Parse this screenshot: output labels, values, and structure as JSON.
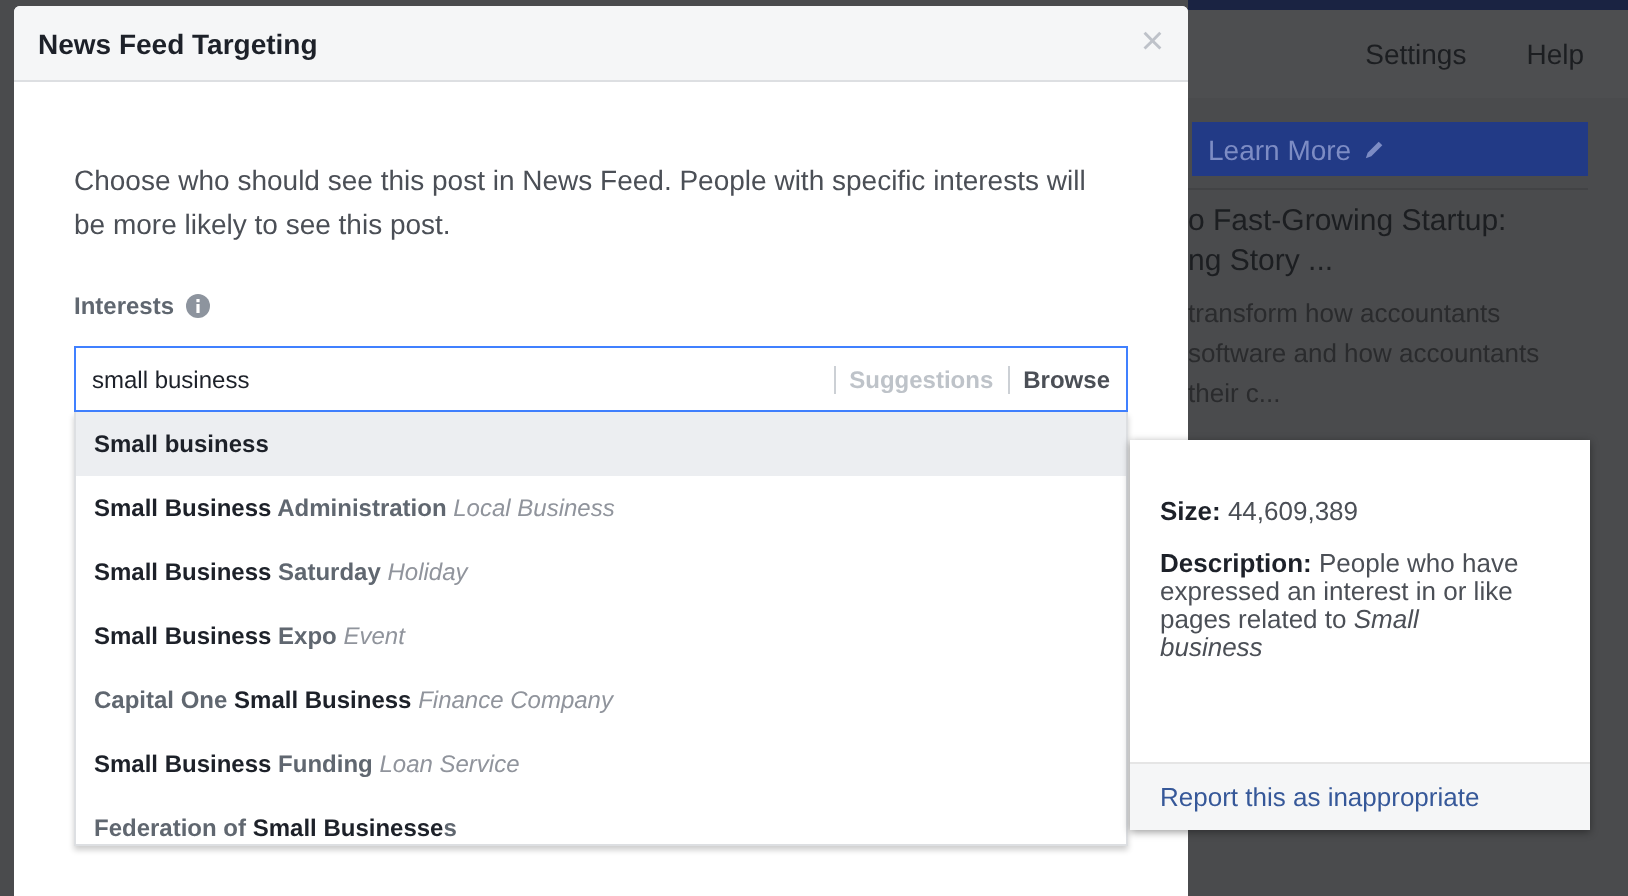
{
  "background": {
    "nav": [
      "Settings",
      "Help"
    ],
    "button": "Learn More",
    "headline": [
      "o Fast-Growing Startup:",
      "ng Story ..."
    ],
    "snippet": [
      "transform how accountants",
      "software and how accountants",
      "their c..."
    ]
  },
  "dialog": {
    "title": "News Feed Targeting",
    "close": "×",
    "intro": "Choose who should see this post in News Feed. People with specific interests will be more likely to see this post.",
    "field_label": "Interests",
    "search": {
      "value": "small business",
      "links": [
        "Suggestions",
        "Browse"
      ]
    },
    "suggestions": [
      {
        "name": "**Small business**",
        "selected": true
      },
      {
        "name": "**Small Business** Administration",
        "category": "Local Business",
        "selected": false
      },
      {
        "name": "**Small Business** Saturday",
        "category": "Holiday",
        "selected": false
      },
      {
        "name": "**Small Business** Expo",
        "category": "Event",
        "selected": false
      },
      {
        "name": "Capital One **Small Business**",
        "category": "Finance Company",
        "selected": false
      },
      {
        "name": "**Small Business** Funding",
        "category": "Loan Service",
        "selected": false
      },
      {
        "name": "Federation of **Small Businesse**s",
        "selected": false
      }
    ],
    "details": {
      "size": "**Size:** 44,609,389",
      "description": "**Description:** People who have expressed an interest in or like pages related to *Small business*",
      "report": "Report this as inappropriate"
    }
  }
}
